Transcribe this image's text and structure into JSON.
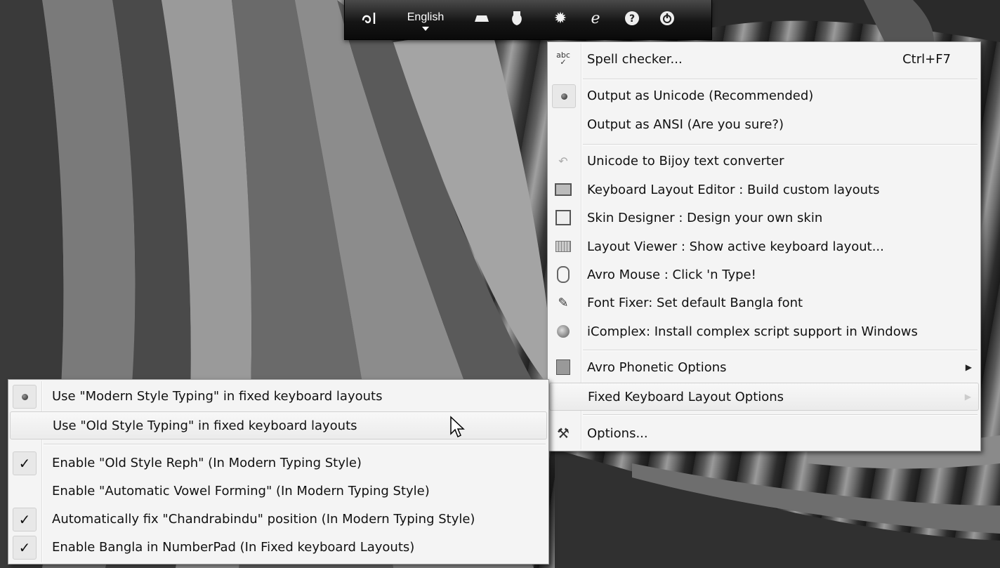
{
  "toolbar": {
    "language_label": "English",
    "icons": [
      "avro-logo-icon",
      "keyboard-layout-icon",
      "layout-viewer-icon",
      "settings-gear-icon",
      "web-icon",
      "help-icon",
      "power-icon"
    ]
  },
  "tools_menu": {
    "items": [
      {
        "label": "Spell checker...",
        "shortcut": "Ctrl+F7",
        "icon": "spellcheck-icon"
      },
      {
        "label": "Output as Unicode (Recommended)",
        "state": "selected-radio"
      },
      {
        "label": "Output as ANSI (Are you sure?)"
      },
      {
        "label": "Unicode to Bijoy text converter",
        "icon": "converter-icon"
      },
      {
        "label": "Keyboard Layout Editor : Build custom layouts",
        "icon": "keyboard-editor-icon"
      },
      {
        "label": "Skin Designer : Design your own skin",
        "icon": "skin-designer-icon"
      },
      {
        "label": "Layout Viewer : Show active keyboard layout...",
        "icon": "layout-viewer-icon"
      },
      {
        "label": "Avro Mouse : Click 'n Type!",
        "icon": "mouse-icon"
      },
      {
        "label": "Font Fixer: Set default Bangla font",
        "icon": "font-fixer-icon"
      },
      {
        "label": "iComplex: Install complex script support in Windows",
        "icon": "icomplex-icon"
      },
      {
        "label": "Avro Phonetic Options",
        "submenu": true,
        "icon": "phonetic-icon"
      },
      {
        "label": "Fixed Keyboard Layout Options",
        "submenu": true,
        "highlighted": true
      },
      {
        "label": "Options...",
        "icon": "options-icon"
      }
    ]
  },
  "fixed_layout_submenu": {
    "items": [
      {
        "label": "Use \"Modern Style Typing\" in fixed keyboard layouts",
        "state": "selected-radio"
      },
      {
        "label": "Use \"Old Style Typing\" in fixed keyboard layouts",
        "highlighted": true
      },
      {
        "label": "Enable \"Old Style Reph\" (In Modern Typing Style)",
        "state": "checked"
      },
      {
        "label": "Enable \"Automatic Vowel Forming\" (In Modern Typing Style)",
        "state": "unchecked"
      },
      {
        "label": "Automatically fix \"Chandrabindu\" position (In Modern Typing Style)",
        "state": "checked"
      },
      {
        "label": "Enable Bangla in NumberPad (In Fixed keyboard Layouts)",
        "state": "checked"
      }
    ]
  },
  "colors": {
    "menu_bg": "#f4f4f4",
    "toolbar_bg": "#151515",
    "highlight": "#ebebeb"
  }
}
